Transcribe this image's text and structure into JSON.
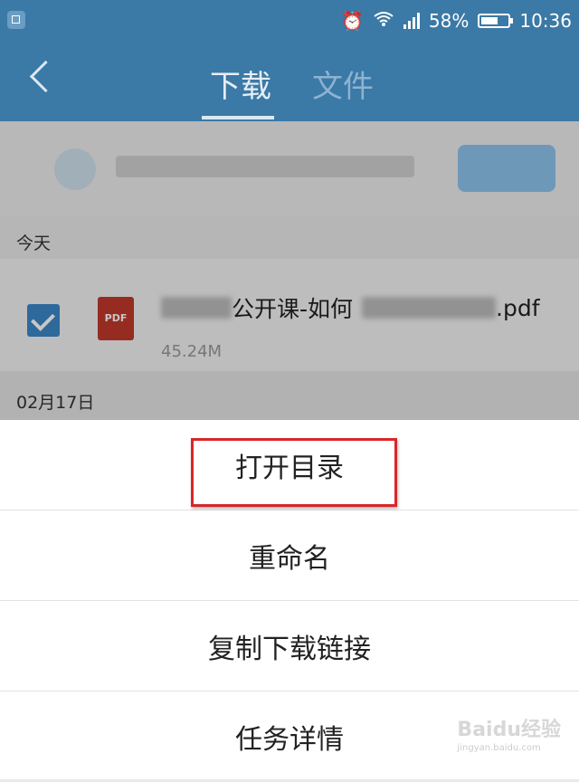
{
  "status_bar": {
    "battery": "58%",
    "time": "10:36",
    "icons": [
      "alarm-icon",
      "wifi-icon",
      "signal-icon",
      "battery-icon"
    ]
  },
  "header": {
    "tabs": [
      {
        "label": "下载",
        "active": true
      },
      {
        "label": "文件",
        "active": false
      }
    ]
  },
  "list": {
    "section_today": "今天",
    "file": {
      "icon_label": "PDF",
      "name_visible": "公开课-如何",
      "extension": ".pdf",
      "size": "45.24M",
      "checked": true
    },
    "section_date": "02月17日"
  },
  "sheet": {
    "items": [
      "打开目录",
      "重命名",
      "复制下载链接",
      "任务详情"
    ]
  },
  "watermark": {
    "brand": "Baidu经验",
    "url": "jingyan.baidu.com"
  },
  "colors": {
    "header_bg": "#3b79a6",
    "highlight_border": "#d9262a",
    "checkbox": "#3b87c8",
    "pdf_icon": "#c0392b"
  }
}
